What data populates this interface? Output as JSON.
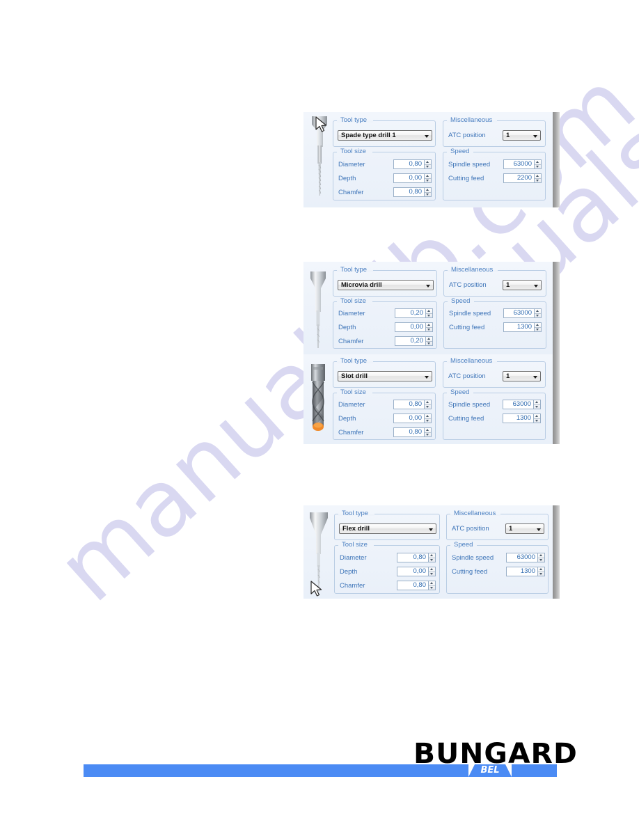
{
  "page": {
    "background_color": "#ffffff",
    "watermark_text": "manualslib.com",
    "watermark_color": "#c9c8ec"
  },
  "footer": {
    "brand": "BUNGARD",
    "sub_brand": "BEL",
    "bar_color": "#4b8bf4"
  },
  "labels": {
    "tool_type": "Tool type",
    "tool_size": "Tool size",
    "miscellaneous": "Miscellaneous",
    "speed": "Speed",
    "diameter": "Diameter",
    "depth": "Depth",
    "chamfer": "Chamfer",
    "atc_position": "ATC position",
    "spindle_speed": "Spindle speed",
    "cutting_feed": "Cutting feed"
  },
  "panels": [
    {
      "id": "spade-type-drill",
      "tool_type": "Spade type drill  1",
      "diameter": "0,80",
      "depth": "0,00",
      "chamfer": "0,80",
      "atc_position": "1",
      "spindle_speed": "63000",
      "cutting_feed": "2200",
      "bit_icon": "spade-type-drill-bit",
      "cursor_visible": true
    },
    {
      "id": "microvia-drill",
      "tool_type": "Microvia drill",
      "diameter": "0,20",
      "depth": "0,00",
      "chamfer": "0,20",
      "atc_position": "1",
      "spindle_speed": "63000",
      "cutting_feed": "1300",
      "bit_icon": "microvia-drill-bit",
      "cursor_visible": false
    },
    {
      "id": "slot-drill",
      "tool_type": "Slot drill",
      "diameter": "0,80",
      "depth": "0,00",
      "chamfer": "0,80",
      "atc_position": "1",
      "spindle_speed": "63000",
      "cutting_feed": "1300",
      "bit_icon": "slot-drill-bit",
      "cursor_visible": false
    },
    {
      "id": "flex-drill",
      "tool_type": "Flex drill",
      "diameter": "0,80",
      "depth": "0,00",
      "chamfer": "0,80",
      "atc_position": "1",
      "spindle_speed": "63000",
      "cutting_feed": "1300",
      "bit_icon": "flex-drill-bit",
      "cursor_visible": true
    }
  ]
}
